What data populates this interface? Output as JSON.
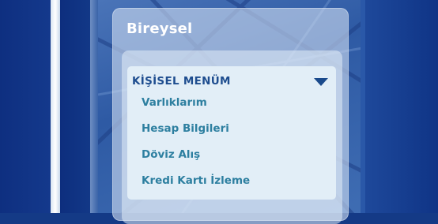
{
  "panel": {
    "title": "Bireysel"
  },
  "menu": {
    "header": "KİŞİSEL MENÜM",
    "expanded": true,
    "items": [
      {
        "label": "Varlıklarım"
      },
      {
        "label": "Hesap Bilgileri"
      },
      {
        "label": "Döviz Alış"
      },
      {
        "label": "Kredi Kartı İzleme"
      }
    ]
  },
  "colors": {
    "background": "#143a86",
    "title_text": "#ffffff",
    "menu_header_text": "#1e4d8f",
    "menu_item_text": "#2d7fa0",
    "menu_box": "#e2eef7"
  },
  "icons": {
    "menu_toggle": "chevron-down-icon"
  }
}
